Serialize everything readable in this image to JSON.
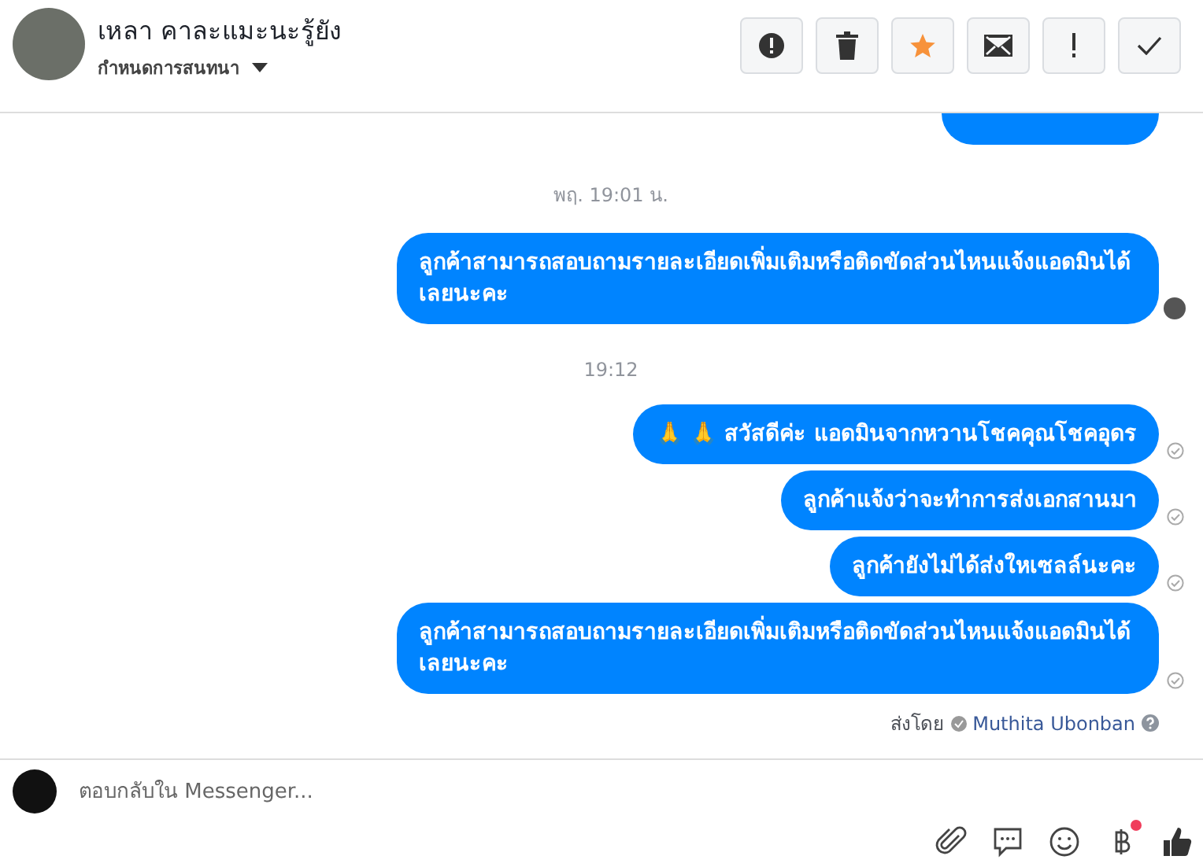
{
  "header": {
    "name": "เหลา คาละแมะนะรู้ยัง",
    "subtitle": "กำหนดการสนทนา",
    "actions": [
      {
        "kind": "report",
        "on": false
      },
      {
        "kind": "trash",
        "on": false
      },
      {
        "kind": "star",
        "on": true
      },
      {
        "kind": "mail",
        "on": false
      },
      {
        "kind": "important",
        "on": false
      },
      {
        "kind": "done",
        "on": false
      }
    ]
  },
  "thread": [
    {
      "kind": "partial"
    },
    {
      "kind": "time",
      "text": "พฤ. 19:01 น."
    },
    {
      "kind": "message",
      "text": "ลูกค้าสามารถสอบถามรายละเอียดเพิ่มเติมหรือติดขัดส่วนไหนแจ้งแอดมินได้เลยนะคะ",
      "seen": true
    },
    {
      "kind": "time",
      "text": "19:12"
    },
    {
      "kind": "message",
      "text": "🙏 🙏 สวัสดีค่ะ แอดมินจากหวานโชคคุณโชคอุดร",
      "seen": false
    },
    {
      "kind": "message",
      "text": "ลูกค้าแจ้งว่าจะทำการส่งเอกสานมา",
      "seen": false
    },
    {
      "kind": "message",
      "text": "ลูกค้ายังไม่ได้ส่งใหเซลล์นะคะ",
      "seen": false
    },
    {
      "kind": "message",
      "text": "ลูกค้าสามารถสอบถามรายละเอียดเพิ่มเติมหรือติดขัดส่วนไหนแจ้งแอดมินได้เลยนะคะ",
      "seen": false
    }
  ],
  "sent_by": {
    "label": "ส่งโดย",
    "name": "Muthita Ubonban"
  },
  "composer": {
    "placeholder": "ตอบกลับใน Messenger...",
    "tools": [
      {
        "kind": "attach",
        "badge": false
      },
      {
        "kind": "chat",
        "badge": false
      },
      {
        "kind": "emoji",
        "badge": false
      },
      {
        "kind": "baht",
        "badge": true
      },
      {
        "kind": "like",
        "badge": false
      }
    ]
  }
}
